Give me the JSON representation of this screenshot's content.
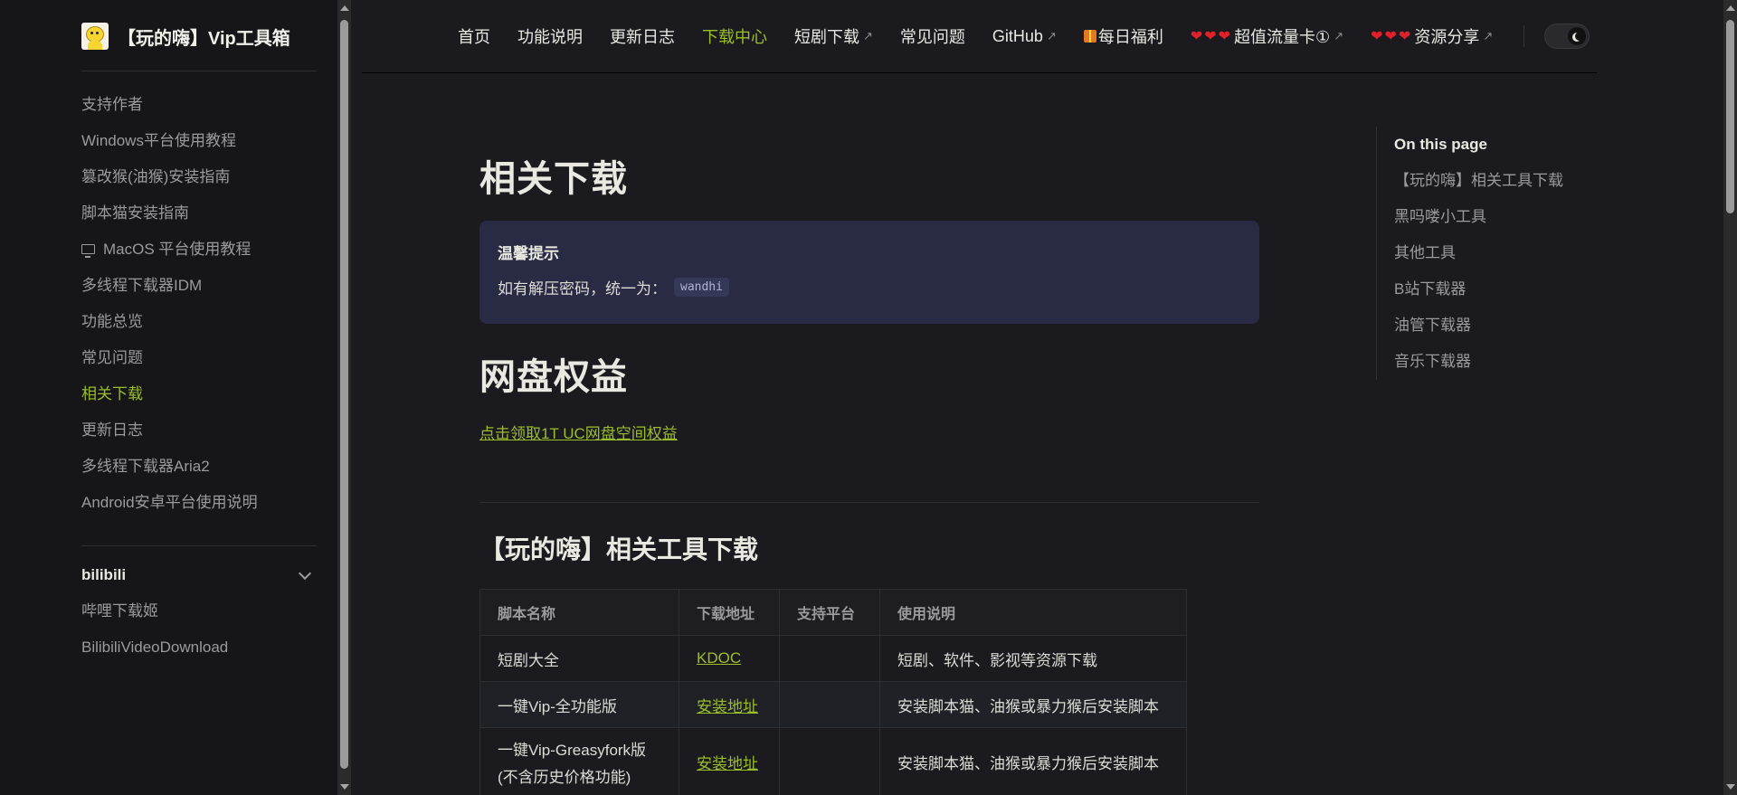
{
  "brand": {
    "title": "【玩的嗨】Vip工具箱"
  },
  "sidebar": {
    "items": [
      {
        "label": "支持作者"
      },
      {
        "label": "Windows平台使用教程"
      },
      {
        "label": "篡改猴(油猴)安装指南"
      },
      {
        "label": "脚本猫安装指南"
      },
      {
        "label": "MacOS 平台使用教程",
        "icon": "monitor-icon"
      },
      {
        "label": "多线程下载器IDM"
      },
      {
        "label": "功能总览"
      },
      {
        "label": "常见问题"
      },
      {
        "label": "相关下载",
        "active": true
      },
      {
        "label": "更新日志"
      },
      {
        "label": "多线程下载器Aria2"
      },
      {
        "label": "Android安卓平台使用说明"
      }
    ],
    "group": {
      "title": "bilibili",
      "items": [
        {
          "label": "哔哩下载姬"
        },
        {
          "label": "BilibiliVideoDownload"
        }
      ]
    }
  },
  "topnav": {
    "items": [
      {
        "label": "首页"
      },
      {
        "label": "功能说明"
      },
      {
        "label": "更新日志"
      },
      {
        "label": "下载中心",
        "active": true
      },
      {
        "label": "短剧下载",
        "external": true
      },
      {
        "label": "常见问题"
      },
      {
        "label": "GitHub",
        "external": true
      },
      {
        "label": "每日福利",
        "icon": "gift-icon"
      },
      {
        "label": "超值流量卡①",
        "hearts": "❤❤❤",
        "external": true
      },
      {
        "label": "资源分享",
        "hearts": "❤❤❤",
        "external": true
      }
    ],
    "external_glyph": "↗"
  },
  "content": {
    "h1": "相关下载",
    "tip": {
      "title": "温馨提示",
      "text": "如有解压密码，统一为：",
      "code": "wandhi"
    },
    "h2": "网盘权益",
    "uc_link": "点击领取1T UC网盘空间权益",
    "h3": "【玩的嗨】相关工具下载",
    "table": {
      "headers": [
        "脚本名称",
        "下载地址",
        "支持平台",
        "使用说明"
      ],
      "rows": [
        {
          "name": "短剧大全",
          "link": "KDOC",
          "platform": "",
          "desc": "短剧、软件、影视等资源下载"
        },
        {
          "name": "一键Vip-全功能版",
          "link": "安装地址",
          "platform": "",
          "desc": "安装脚本猫、油猴或暴力猴后安装脚本"
        },
        {
          "name": "一键Vip-Greasyfork版",
          "name2": "(不含历史价格功能)",
          "link": "安装地址",
          "platform": "",
          "desc": "安装脚本猫、油猴或暴力猴后安装脚本"
        }
      ]
    }
  },
  "toc": {
    "title": "On this page",
    "items": [
      "【玩的嗨】相关工具下载",
      "黑吗喽小工具",
      "其他工具",
      "B站下载器",
      "油管下载器",
      "音乐下载器"
    ]
  },
  "colors": {
    "accent": "#9bbd2c",
    "background": "#1b1b1f",
    "sidebar": "#161618",
    "tip": "#292a44",
    "heart": "#e0202a"
  }
}
